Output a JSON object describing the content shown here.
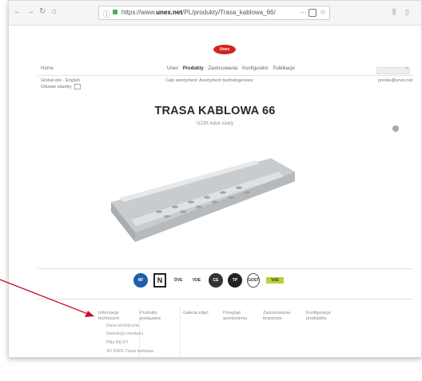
{
  "browser": {
    "url_prefix": "https://www.",
    "url_domain": "unex.net",
    "url_path": "/PL/produkty/Trasa_kablowa_66/",
    "more_icon": "···",
    "star_icon": "☆"
  },
  "site": {
    "logo_text": "Unex",
    "home": "Home",
    "menu": [
      "Unex",
      "Produkty",
      "Zastosowania",
      "Konfigurator",
      "Publikacje"
    ],
    "global_site": "Global site - English",
    "choose_country": "Choose country",
    "sub_menu": [
      "Cały asortyment",
      "Asortyment bezhalogenowy"
    ],
    "email": "poreks@unex.net"
  },
  "product": {
    "title": "TRASA KABLOWA 66",
    "subtitle": "U23X kolor szary"
  },
  "certifications": [
    "NF",
    "N",
    "ÖVE",
    "VDE",
    "CE",
    "TP",
    "GOST",
    "VdS"
  ],
  "tabs": [
    {
      "line1": "Informacje",
      "line2": "techniczne"
    },
    {
      "line1": "Produkty",
      "line2": "powiązane"
    },
    {
      "line1": "Galeria zdjęć",
      "line2": ""
    },
    {
      "line1": "Przegląd",
      "line2": "asortymentu"
    },
    {
      "line1": "Zastosowania",
      "line2": "branżowe"
    },
    {
      "line1": "Konfiguracja",
      "line2": "produktów"
    }
  ],
  "links": [
    "Dane techniczne",
    "Instrukcja montażu",
    "Pliki REVIT",
    "3D DWG Trasa kablowa"
  ],
  "colors": {
    "accent": "#d5221e",
    "arrow": "#c8102e"
  }
}
